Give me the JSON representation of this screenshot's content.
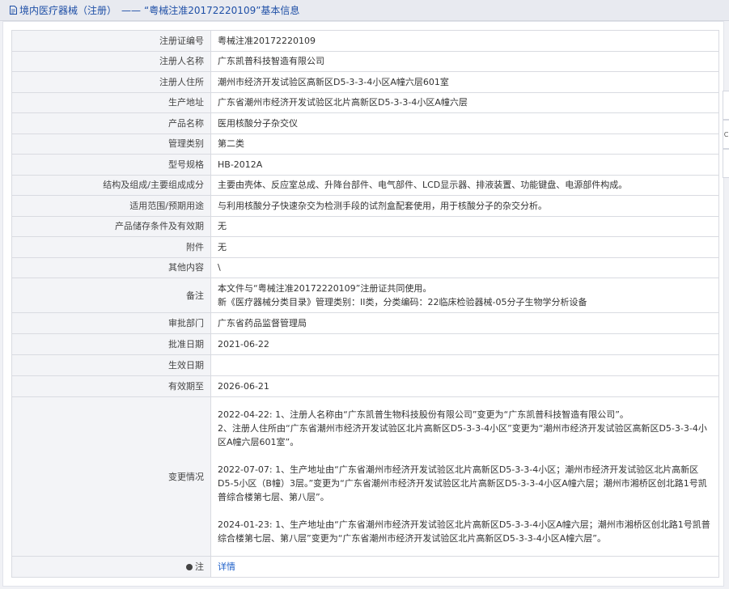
{
  "header": {
    "title_a": "境内医疗器械（注册）",
    "dash": "——",
    "title_b": "“粤械注准20172220109”基本信息",
    "icon": "document-icon"
  },
  "rows": [
    {
      "label": "注册证编号",
      "value": "粤械注准20172220109"
    },
    {
      "label": "注册人名称",
      "value": "广东凯普科技智造有限公司"
    },
    {
      "label": "注册人住所",
      "value": "潮州市经济开发试验区高新区D5-3-3-4小区A幢六层601室"
    },
    {
      "label": "生产地址",
      "value": "广东省潮州市经济开发试验区北片高新区D5-3-3-4小区A幢六层"
    },
    {
      "label": "产品名称",
      "value": "医用核酸分子杂交仪"
    },
    {
      "label": "管理类别",
      "value": "第二类"
    },
    {
      "label": "型号规格",
      "value": "HB-2012A"
    },
    {
      "label": "结构及组成/主要组成成分",
      "value": "主要由壳体、反应室总成、升降台部件、电气部件、LCD显示器、排液装置、功能键盘、电源部件构成。"
    },
    {
      "label": "适用范围/预期用途",
      "value": "与利用核酸分子快速杂交为检测手段的试剂盒配套使用，用于核酸分子的杂交分析。"
    },
    {
      "label": "产品储存条件及有效期",
      "value": "无"
    },
    {
      "label": "附件",
      "value": "无"
    },
    {
      "label": "其他内容",
      "value": "\\"
    }
  ],
  "remark": {
    "label": "备注",
    "line1": "本文件与“粤械注准20172220109”注册证共同使用。",
    "line2": "新《医疗器械分类目录》管理类别：II类，分类编码：22临床检验器械-05分子生物学分析设备"
  },
  "rows2": [
    {
      "label": "审批部门",
      "value": "广东省药品监督管理局"
    },
    {
      "label": "批准日期",
      "value": "2021-06-22"
    },
    {
      "label": "生效日期",
      "value": ""
    },
    {
      "label": "有效期至",
      "value": "2026-06-21"
    }
  ],
  "changes": {
    "label": "变更情况",
    "entries": [
      "2022-04-22: 1、注册人名称由“广东凯普生物科技股份有限公司”变更为“广东凯普科技智造有限公司”。\n2、注册人住所由“广东省潮州市经济开发试验区北片高新区D5-3-3-4小区”变更为“潮州市经济开发试验区高新区D5-3-3-4小区A幢六层601室”。",
      "2022-07-07: 1、生产地址由“广东省潮州市经济开发试验区北片高新区D5-3-3-4小区；潮州市经济开发试验区北片高新区D5-5小区（B幢）3层。”变更为“广东省潮州市经济开发试验区北片高新区D5-3-3-4小区A幢六层；潮州市湘桥区创北路1号凯普综合楼第七层、第八层”。",
      "2024-01-23: 1、生产地址由“广东省潮州市经济开发试验区北片高新区D5-3-3-4小区A幢六层；潮州市湘桥区创北路1号凯普综合楼第七层、第八层”变更为“广东省潮州市经济开发试验区北片高新区D5-3-3-4小区A幢六层”。"
    ]
  },
  "note": {
    "label": "注",
    "link": "详情",
    "icon": "pin-icon"
  },
  "side_tabs": [
    "",
    "C",
    ""
  ]
}
